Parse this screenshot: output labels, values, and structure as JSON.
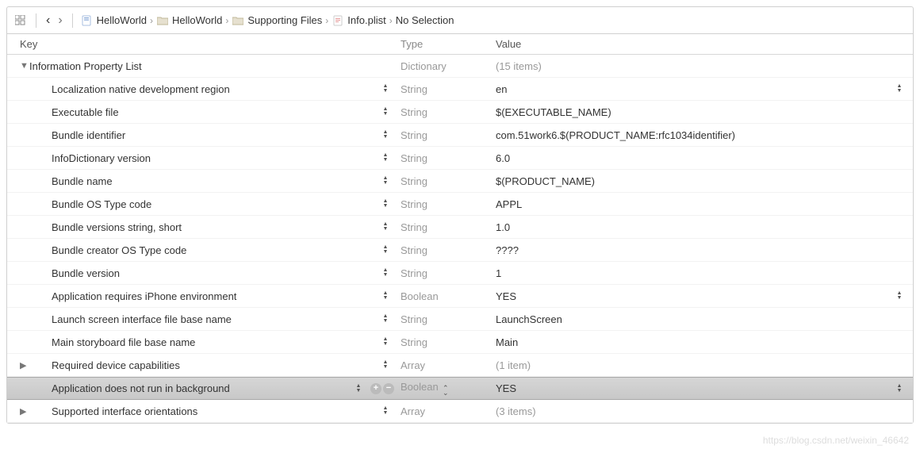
{
  "breadcrumb": {
    "items": [
      {
        "label": "HelloWorld",
        "icon": "project"
      },
      {
        "label": "HelloWorld",
        "icon": "folder"
      },
      {
        "label": "Supporting Files",
        "icon": "folder"
      },
      {
        "label": "Info.plist",
        "icon": "plist"
      },
      {
        "label": "No Selection",
        "icon": ""
      }
    ]
  },
  "columns": {
    "key": "Key",
    "type": "Type",
    "value": "Value"
  },
  "root": {
    "key": "Information Property List",
    "type": "Dictionary",
    "value": "(15 items)"
  },
  "rows": [
    {
      "key": "Localization native development region",
      "type": "String",
      "value": "en",
      "valueStepper": true
    },
    {
      "key": "Executable file",
      "type": "String",
      "value": "$(EXECUTABLE_NAME)"
    },
    {
      "key": "Bundle identifier",
      "type": "String",
      "value": "com.51work6.$(PRODUCT_NAME:rfc1034identifier)"
    },
    {
      "key": "InfoDictionary version",
      "type": "String",
      "value": "6.0"
    },
    {
      "key": "Bundle name",
      "type": "String",
      "value": "$(PRODUCT_NAME)"
    },
    {
      "key": "Bundle OS Type code",
      "type": "String",
      "value": "APPL"
    },
    {
      "key": "Bundle versions string, short",
      "type": "String",
      "value": "1.0"
    },
    {
      "key": "Bundle creator OS Type code",
      "type": "String",
      "value": "????"
    },
    {
      "key": "Bundle version",
      "type": "String",
      "value": "1"
    },
    {
      "key": "Application requires iPhone environment",
      "type": "Boolean",
      "value": "YES",
      "valueStepper": true
    },
    {
      "key": "Launch screen interface file base name",
      "type": "String",
      "value": "LaunchScreen"
    },
    {
      "key": "Main storyboard file base name",
      "type": "String",
      "value": "Main"
    },
    {
      "key": "Required device capabilities",
      "type": "Array",
      "value": "(1 item)",
      "disclosure": "closed",
      "muteValue": true
    },
    {
      "key": "Application does not run in background",
      "type": "Boolean",
      "value": "YES",
      "selected": true,
      "valueStepper": true,
      "plusMinus": true,
      "typeStepperOpen": true
    },
    {
      "key": "Supported interface orientations",
      "type": "Array",
      "value": "(3 items)",
      "disclosure": "closed",
      "muteValue": true
    }
  ],
  "watermark": "https://blog.csdn.net/weixin_46642"
}
